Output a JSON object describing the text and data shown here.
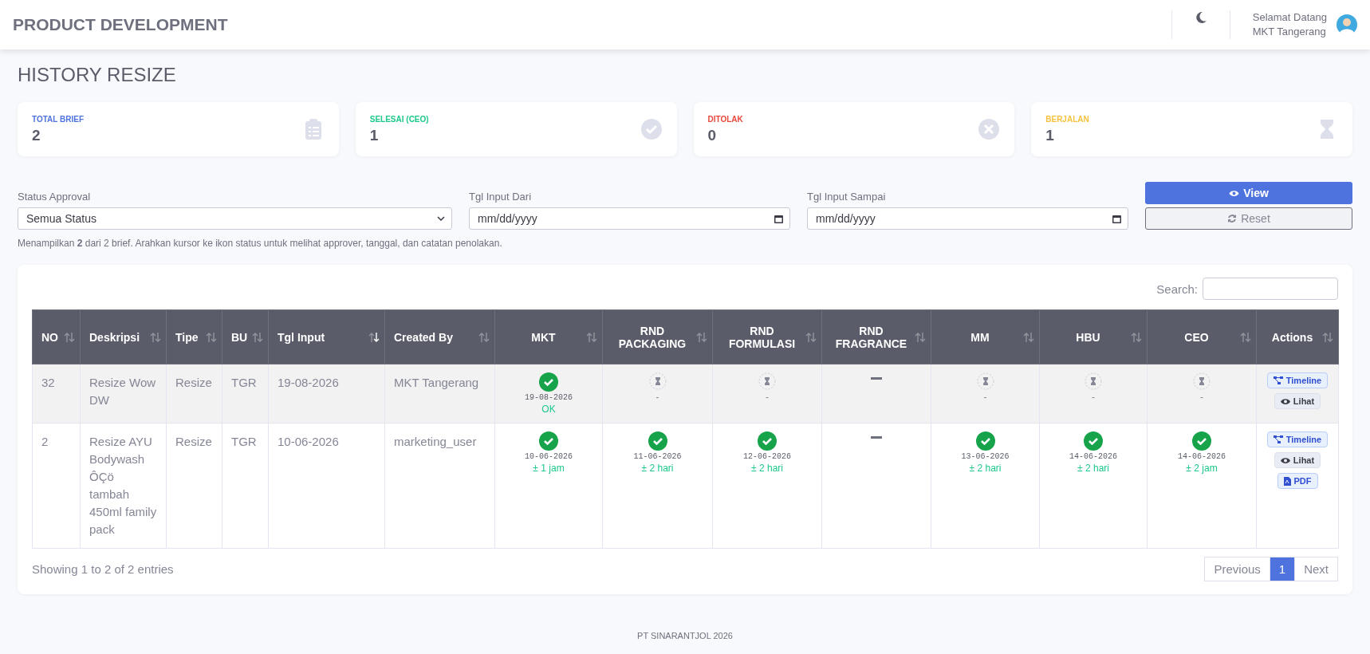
{
  "header": {
    "title": "PRODUCT DEVELOPMENT",
    "greeting": "Selamat Datang",
    "user": "MKT Tangerang"
  },
  "page_title": "HISTORY RESIZE",
  "stats": [
    {
      "label": "TOTAL BRIEF",
      "value": "2",
      "color": "#4e73df",
      "kind": "clipboard"
    },
    {
      "label": "SELESAI (CEO)",
      "value": "1",
      "color": "#1cc88a",
      "kind": "check"
    },
    {
      "label": "DITOLAK",
      "value": "0",
      "color": "#e74a3b",
      "kind": "cross"
    },
    {
      "label": "BERJALAN",
      "value": "1",
      "color": "#f6c23e",
      "kind": "hourglass"
    }
  ],
  "filters": {
    "status": {
      "label": "Status Approval",
      "value": "Semua Status"
    },
    "date_from": {
      "label": "Tgl Input Dari",
      "placeholder": "mm/dd/yyyy"
    },
    "date_to": {
      "label": "Tgl Input Sampai",
      "placeholder": "mm/dd/yyyy"
    },
    "view_button": "View",
    "reset_button": "Reset"
  },
  "info": "Menampilkan **2** dari 2 brief. Arahkan kursor ke ikon status untuk melihat approver, tanggal, dan catatan penolakan.",
  "search": {
    "label": "Search:"
  },
  "columns": [
    {
      "label": "NO",
      "sorted": false
    },
    {
      "label": "Deskripsi",
      "sorted": false
    },
    {
      "label": "Tipe",
      "sorted": false
    },
    {
      "label": "BU",
      "sorted": false
    },
    {
      "label": "Tgl Input",
      "sorted": true
    },
    {
      "label": "Created By",
      "sorted": false
    },
    {
      "label": "MKT",
      "sorted": false
    },
    {
      "label": "RND PACKAGING",
      "sorted": false
    },
    {
      "label": "RND FORMULASI",
      "sorted": false
    },
    {
      "label": "RND FRAGRANCE",
      "sorted": false
    },
    {
      "label": "MM",
      "sorted": false
    },
    {
      "label": "HBU",
      "sorted": false
    },
    {
      "label": "CEO",
      "sorted": false
    },
    {
      "label": "Actions",
      "sorted": false
    }
  ],
  "rows": [
    {
      "no": "32",
      "deskripsi": "Resize Wow DW",
      "tipe": "Resize",
      "bu": "TGR",
      "tgl_input": "19-08-2026",
      "created_by": "MKT Tangerang",
      "approvals": [
        {
          "kind": "approved",
          "date": "19-08-2026",
          "note": "OK"
        },
        {
          "kind": "pending",
          "note": "-"
        },
        {
          "kind": "pending",
          "note": "-"
        },
        {
          "kind": "na"
        },
        {
          "kind": "pending",
          "note": "-"
        },
        {
          "kind": "pending",
          "note": "-"
        },
        {
          "kind": "pending",
          "note": "-"
        }
      ],
      "actions": [
        {
          "kind": "timeline",
          "label": "Timeline"
        },
        {
          "kind": "view",
          "label": "Lihat"
        }
      ]
    },
    {
      "no": "2",
      "deskripsi": "Resize AYU Bodywash ÔÇö tambah 450ml family pack",
      "tipe": "Resize",
      "bu": "TGR",
      "tgl_input": "10-06-2026",
      "created_by": "marketing_user",
      "approvals": [
        {
          "kind": "approved",
          "date": "10-06-2026",
          "note": "± 1 jam"
        },
        {
          "kind": "approved",
          "date": "11-06-2026",
          "note": "± 2 hari"
        },
        {
          "kind": "approved",
          "date": "12-06-2026",
          "note": "± 2 hari"
        },
        {
          "kind": "na"
        },
        {
          "kind": "approved",
          "date": "13-06-2026",
          "note": "± 2 hari"
        },
        {
          "kind": "approved",
          "date": "14-06-2026",
          "note": "± 2 hari"
        },
        {
          "kind": "approved",
          "date": "14-06-2026",
          "note": "± 2 jam"
        }
      ],
      "actions": [
        {
          "kind": "timeline",
          "label": "Timeline"
        },
        {
          "kind": "view",
          "label": "Lihat"
        },
        {
          "kind": "pdf",
          "label": "PDF"
        }
      ]
    }
  ],
  "table_info": "Showing 1 to 2 of 2 entries",
  "pagination": [
    {
      "label": "Previous",
      "selected": false
    },
    {
      "label": "1",
      "selected": true
    },
    {
      "label": "Next",
      "selected": false
    }
  ],
  "footer": "PT SINARANTJOL 2026"
}
